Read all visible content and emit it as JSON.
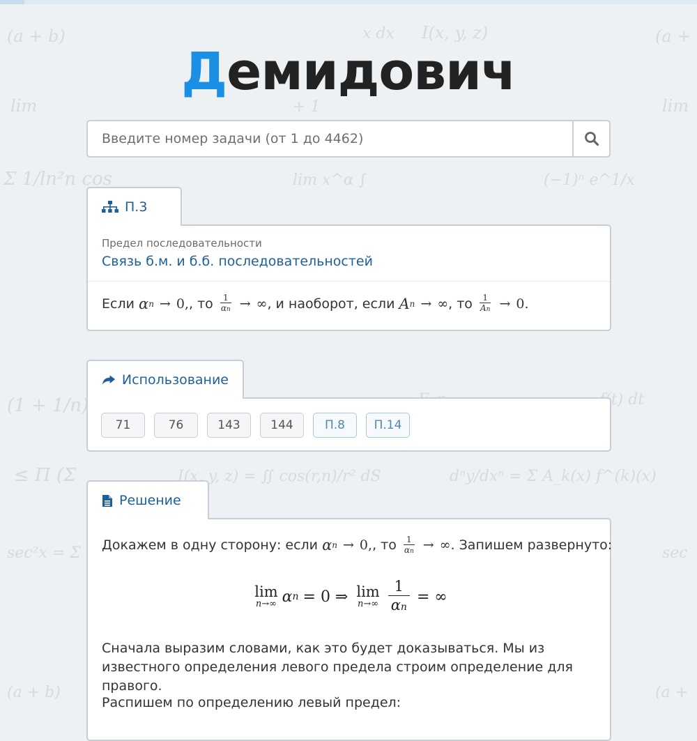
{
  "app": {
    "logo_first_letter": "Д",
    "logo_rest": "емидович",
    "brand_color": "#1a8fe3",
    "link_color": "#1d5f98"
  },
  "search": {
    "placeholder": "Введите номер задачи (от 1 до 4462)",
    "value": "",
    "button_icon": "search-icon"
  },
  "section": {
    "tab_icon": "sitemap-icon",
    "tab_label": "П.3",
    "topic": "Предел последовательности",
    "title": "Связь б.м. и б.б. последовательностей",
    "statement": {
      "t1": "Если",
      "t2": ", то",
      "t3": ", и наоборот, если",
      "t4": ", то",
      "m_alpha": "α",
      "m_sub": "n",
      "m_arrow": "→",
      "m_zero": "0",
      "m_inf": "∞",
      "m_one": "1",
      "m_A": "A",
      "comma": ",",
      "period": "."
    }
  },
  "usage": {
    "tab_icon": "share-icon",
    "tab_label": "Использование",
    "items": [
      "71",
      "76",
      "143",
      "144",
      "П.8",
      "П.14"
    ]
  },
  "solution": {
    "tab_icon": "file-text-icon",
    "tab_label": "Решение",
    "p1_start": "Докажем в одну сторону: если",
    "p1_mid": ", то",
    "p1_end": ". Запишем развернуто:",
    "formula": {
      "lim": "lim",
      "under": "n→∞",
      "eq0": "= 0 ⇒",
      "eqinf": "= ∞"
    },
    "p2": "Сначала выразим словами, как это будет доказываться. Мы из известного определения левого предела строим определение для правого.",
    "p3": "Распишем по определению левый предел:"
  }
}
